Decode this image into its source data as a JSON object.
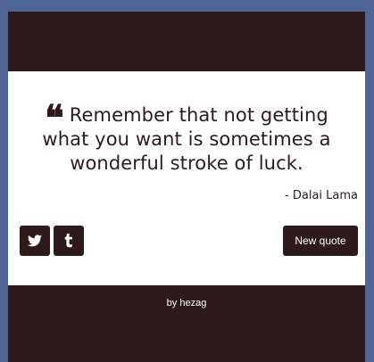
{
  "colors": {
    "background": "#4f6595",
    "accent": "#2e1a1b",
    "card": "#ffffff",
    "button_text": "#ffffff"
  },
  "quote": {
    "text": "Remember that not getting what you want is sometimes a wonderful stroke of luck.",
    "author": "- Dalai Lama",
    "quote_icon": "quote-left-icon"
  },
  "share": {
    "buttons": [
      {
        "icon": "twitter-icon"
      },
      {
        "icon": "tumblr-icon"
      }
    ]
  },
  "actions": {
    "new_quote_label": "New quote"
  },
  "footer": {
    "credit": "by hezag"
  }
}
